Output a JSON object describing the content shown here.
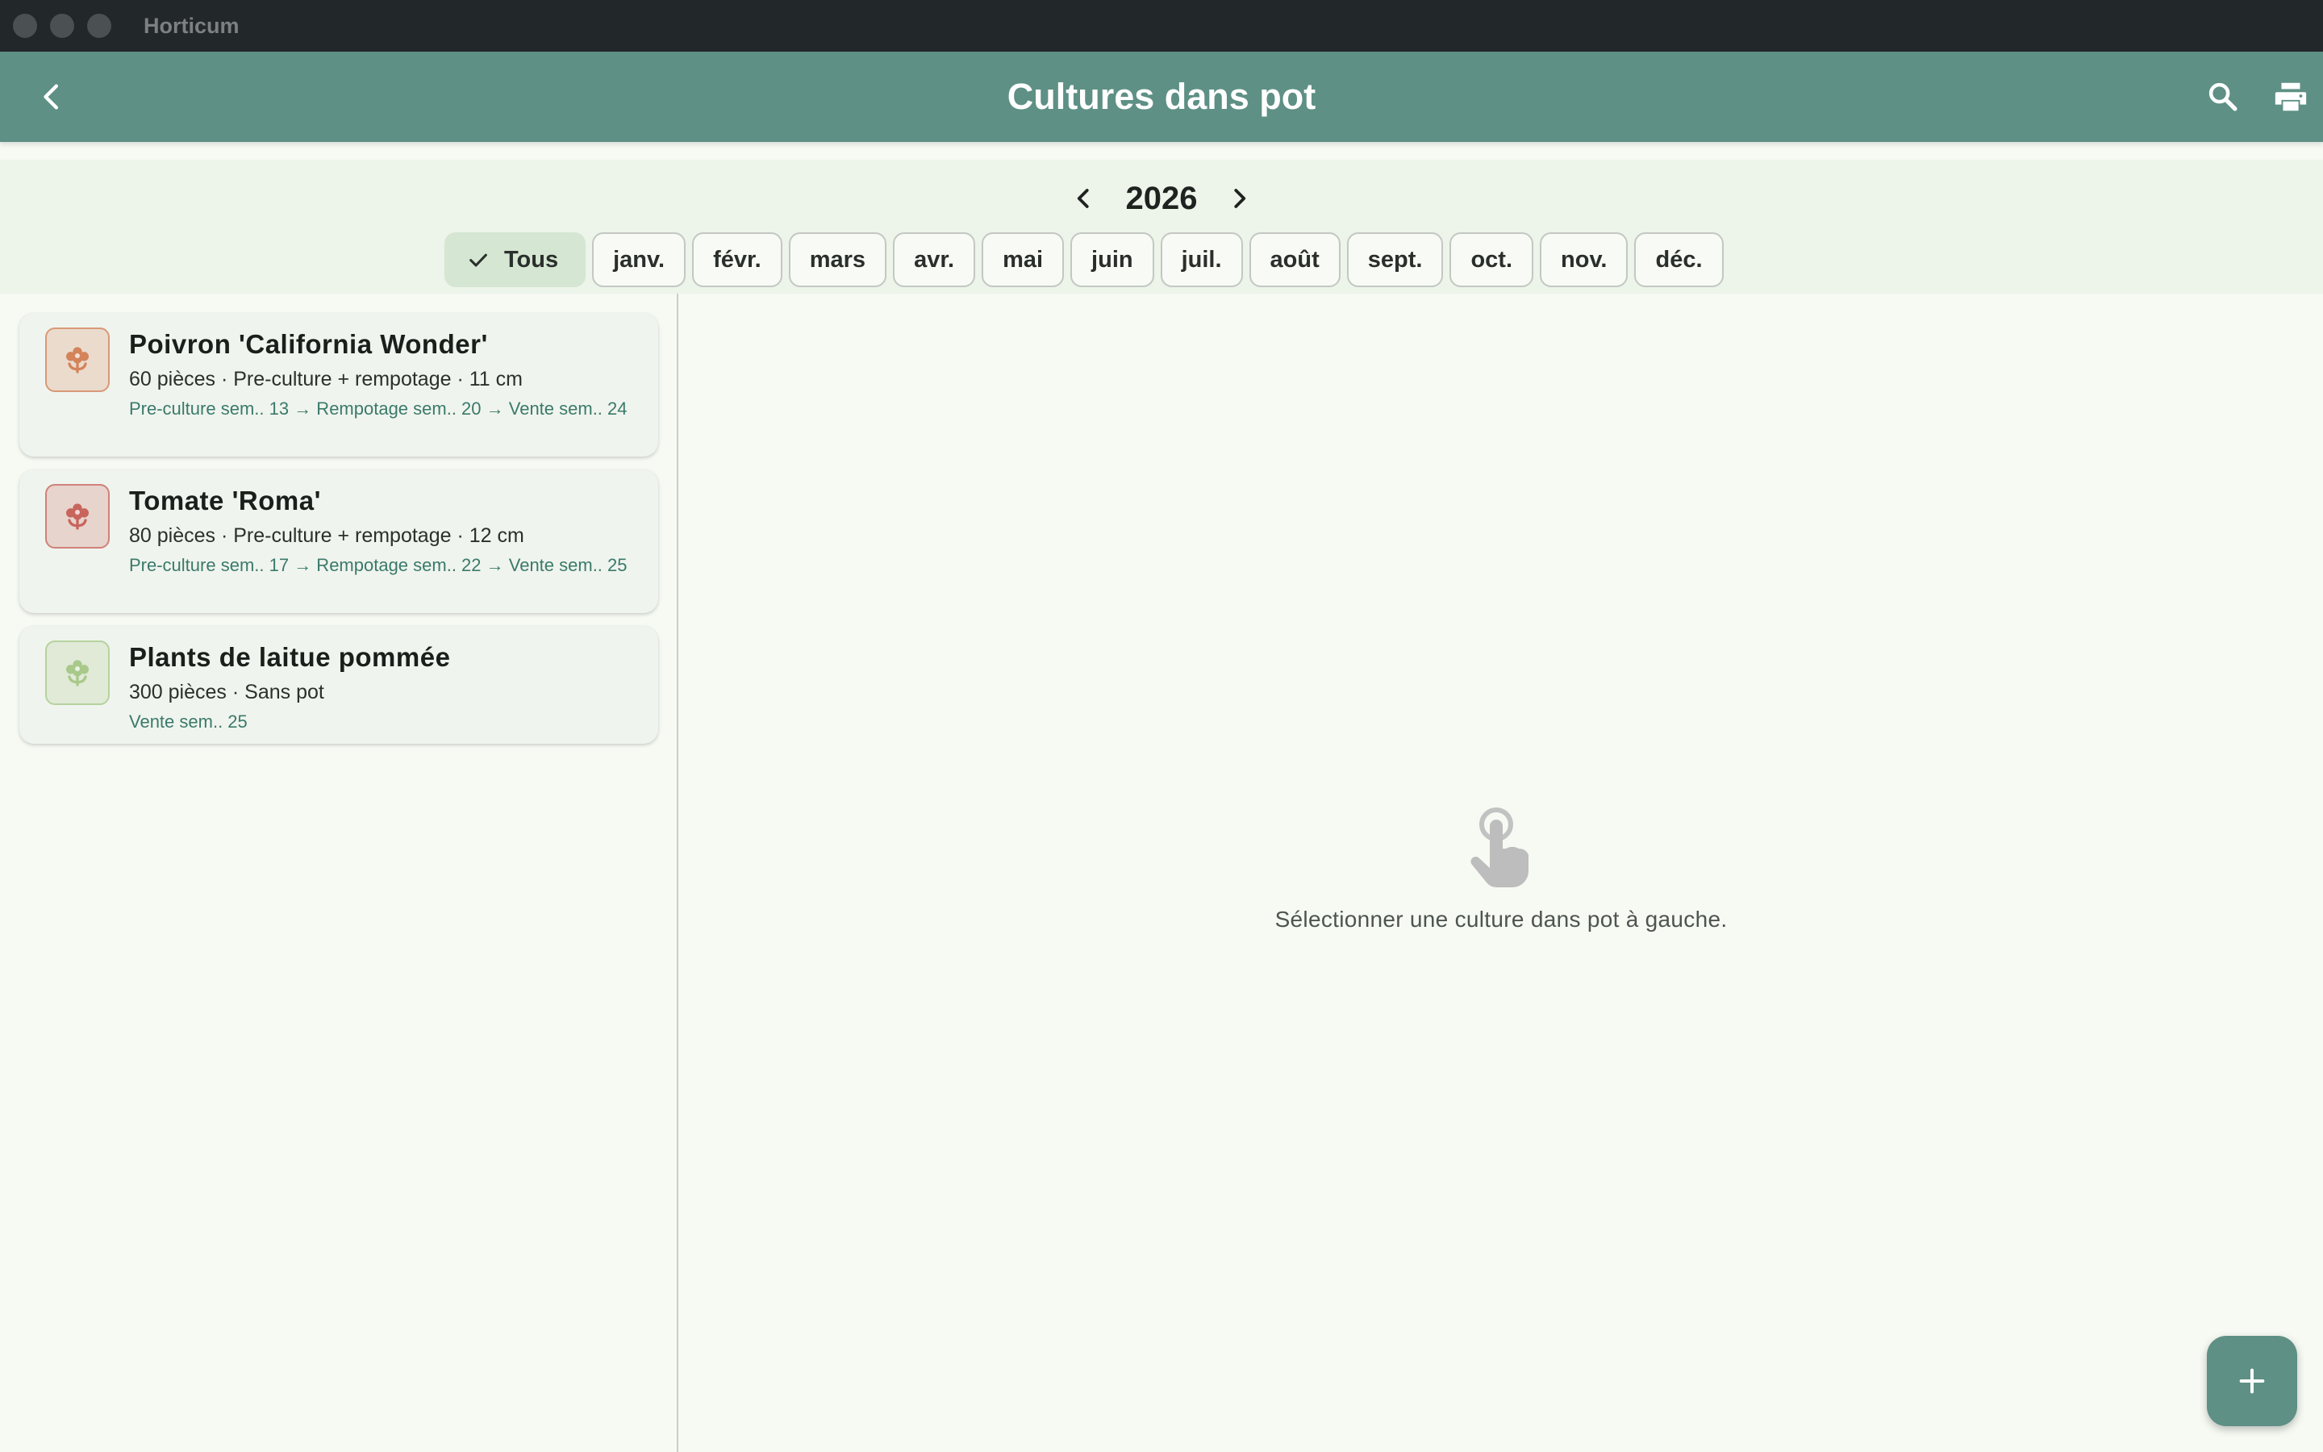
{
  "window": {
    "title": "Horticum"
  },
  "appbar": {
    "title": "Cultures dans pot",
    "back_icon": "chevron-left-icon",
    "search_icon": "search-icon",
    "print_icon": "print-icon"
  },
  "filter": {
    "year": "2026",
    "chips": [
      {
        "label": "Tous",
        "selected": true
      },
      {
        "label": "janv.",
        "selected": false
      },
      {
        "label": "févr.",
        "selected": false
      },
      {
        "label": "mars",
        "selected": false
      },
      {
        "label": "avr.",
        "selected": false
      },
      {
        "label": "mai",
        "selected": false
      },
      {
        "label": "juin",
        "selected": false
      },
      {
        "label": "juil.",
        "selected": false
      },
      {
        "label": "août",
        "selected": false
      },
      {
        "label": "sept.",
        "selected": false
      },
      {
        "label": "oct.",
        "selected": false
      },
      {
        "label": "nov.",
        "selected": false
      },
      {
        "label": "déc.",
        "selected": false
      }
    ]
  },
  "cultures": [
    {
      "name": "Poivron 'California Wonder'",
      "meta": "60 pièces · Pre-culture + rempotage · 11 cm",
      "schedule": "Pre-culture sem.. 13 → Rempotage sem.. 20 → Vente sem.. 24",
      "color": "#d4835a"
    },
    {
      "name": "Tomate 'Roma'",
      "meta": "80 pièces · Pre-culture + rempotage · 12 cm",
      "schedule": "Pre-culture sem.. 17 → Rempotage sem.. 22 → Vente sem.. 25",
      "color": "#c8655c"
    },
    {
      "name": "Plants de laitue pommée",
      "meta": "300 pièces · Sans pot",
      "schedule": "Vente sem.. 25",
      "color": "#a8c98a"
    }
  ],
  "empty_state": {
    "icon": "touch-hand-icon",
    "message": "Sélectionner une culture dans pot à gauche."
  },
  "fab": {
    "icon": "plus-icon"
  },
  "colors": {
    "primary": "#5e9085",
    "background": "#f6faf3",
    "chip_selected": "#d5e6d2",
    "schedule_text": "#3a7a6b"
  }
}
